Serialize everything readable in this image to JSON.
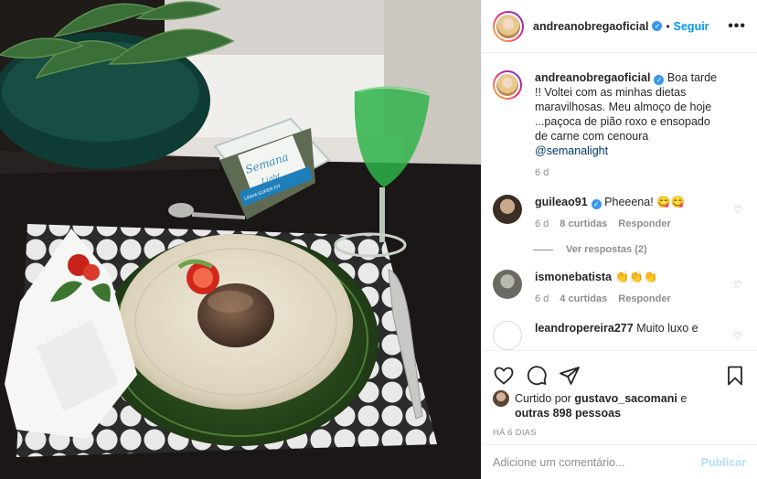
{
  "post": {
    "author": "andreanobregaoficial",
    "follow_label": "Seguir",
    "more_label": "•••",
    "dot": "•",
    "verified_glyph": "✓"
  },
  "caption": {
    "author": "andreanobregaoficial",
    "text": "Boa tarde !! Voltei com as minhas dietas maravilhosas. Meu almoço de hoje ...paçoca de pião roxo e ensopado de carne com cenoura ",
    "mention": "@semanalight",
    "time": "6 d"
  },
  "comments": [
    {
      "user": "guileao91",
      "verified": true,
      "text": "Pheeena! 😋😋",
      "time": "6 d",
      "likes": "8 curtidas",
      "reply_label": "Responder",
      "view_replies": "Ver respostas (2)"
    },
    {
      "user": "ismonebatista",
      "verified": false,
      "text": "👏👏👏",
      "time": "6 d",
      "likes": "4 curtidas",
      "reply_label": "Responder"
    },
    {
      "user": "leandropereira277",
      "verified": false,
      "text": "Muito luxo e"
    }
  ],
  "liked_by": {
    "prefix": "Curtido por ",
    "user": "gustavo_sacomani",
    "middle": " e",
    "others": "outras 898 pessoas"
  },
  "date": "HÁ 6 DIAS",
  "add_comment": {
    "placeholder": "Adicione um comentário...",
    "publish_label": "Publicar"
  },
  "photo": {
    "package_brand": "Semana",
    "package_sub": "Light",
    "package_strip": "LINHA SUPER FIT"
  },
  "icons": [
    "heart-icon",
    "comment-icon",
    "share-icon",
    "bookmark-icon",
    "more-icon"
  ],
  "colors": {
    "link": "#0095f6",
    "verified": "#3897f0",
    "muted": "#8e8e8e",
    "publish_disabled": "#b2dffc"
  }
}
